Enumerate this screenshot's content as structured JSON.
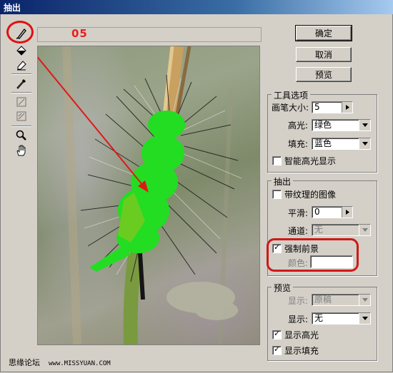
{
  "window": {
    "title": "抽出"
  },
  "tools": [
    {
      "name": "edge-highlighter-icon"
    },
    {
      "name": "fill-bucket-icon"
    },
    {
      "name": "eraser-icon"
    },
    {
      "name": "eyedropper-icon"
    },
    {
      "name": "cleanup-tool-icon"
    },
    {
      "name": "edge-touchup-icon"
    },
    {
      "name": "zoom-icon"
    },
    {
      "name": "hand-icon"
    }
  ],
  "step_label": "05",
  "buttons": {
    "ok": "确定",
    "cancel": "取消",
    "preview": "预览"
  },
  "tool_options": {
    "title": "工具选项",
    "brush_size_label": "画笔大小:",
    "brush_size_value": "5",
    "highlight_label": "高光:",
    "highlight_value": "绿色",
    "fill_label": "填充:",
    "fill_value": "蓝色",
    "smart_highlight_label": "智能高光显示",
    "smart_highlight_checked": false
  },
  "extraction": {
    "title": "抽出",
    "textured_label": "带纹理的图像",
    "textured_checked": false,
    "smooth_label": "平滑:",
    "smooth_value": "0",
    "channel_label": "通道:",
    "channel_value": "无",
    "force_fg_label": "强制前景",
    "force_fg_checked": true,
    "color_label": "颜色:"
  },
  "preview": {
    "title": "预览",
    "show_label": "显示:",
    "show_value": "原稿",
    "display_label": "显示:",
    "display_value": "无",
    "show_highlight_label": "显示高光",
    "show_highlight_checked": true,
    "show_fill_label": "显示填充",
    "show_fill_checked": true
  },
  "footer": {
    "site_name": "思缘论坛",
    "url": "www.MISSYUAN.COM"
  },
  "colors": {
    "highlight_green": "#22dd22",
    "annotation_red": "#e01818",
    "title_blue": "#0a246a"
  }
}
